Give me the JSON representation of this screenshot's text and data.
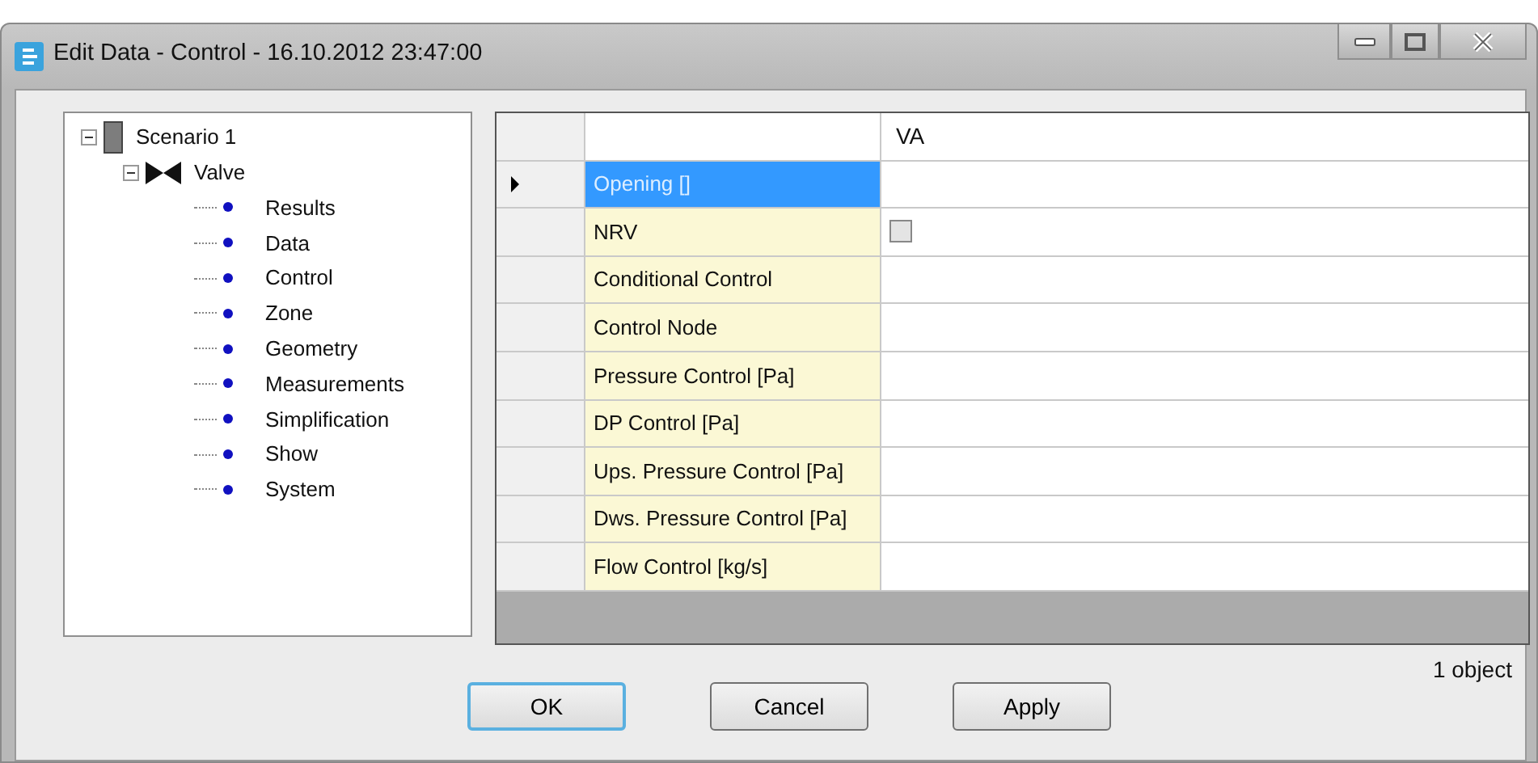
{
  "window": {
    "title": "Edit Data - Control - 16.10.2012 23:47:00"
  },
  "tree": [
    {
      "label": "Scenario 1",
      "kind": "scenario",
      "expanded": true,
      "children": [
        {
          "label": "Valve",
          "kind": "valve",
          "expanded": true,
          "children": [
            {
              "label": "Results",
              "kind": "leaf"
            },
            {
              "label": "Data",
              "kind": "leaf"
            },
            {
              "label": "Control",
              "kind": "leaf"
            },
            {
              "label": "Zone",
              "kind": "leaf"
            },
            {
              "label": "Geometry",
              "kind": "leaf"
            },
            {
              "label": "Measurements",
              "kind": "leaf"
            },
            {
              "label": "Simplification",
              "kind": "leaf"
            },
            {
              "label": "Show",
              "kind": "leaf"
            },
            {
              "label": "System",
              "kind": "leaf"
            }
          ]
        }
      ]
    }
  ],
  "grid": {
    "columns": [
      "VA"
    ],
    "rows": [
      {
        "label": "Opening []",
        "selected": true,
        "kind": "text"
      },
      {
        "label": "NRV",
        "selected": false,
        "kind": "checkbox",
        "checked": false
      },
      {
        "label": "Conditional Control",
        "selected": false,
        "kind": "text"
      },
      {
        "label": "Control Node",
        "selected": false,
        "kind": "text"
      },
      {
        "label": "Pressure Control [Pa]",
        "selected": false,
        "kind": "text"
      },
      {
        "label": "DP Control [Pa]",
        "selected": false,
        "kind": "text"
      },
      {
        "label": "Ups. Pressure Control [Pa]",
        "selected": false,
        "kind": "text"
      },
      {
        "label": "Dws. Pressure Control [Pa]",
        "selected": false,
        "kind": "text"
      },
      {
        "label": "Flow Control [kg/s]",
        "selected": false,
        "kind": "text"
      }
    ]
  },
  "status": "1 object",
  "buttons": [
    {
      "label": "OK",
      "focused": true
    },
    {
      "label": "Cancel",
      "focused": false
    },
    {
      "label": "Apply",
      "focused": false
    }
  ]
}
